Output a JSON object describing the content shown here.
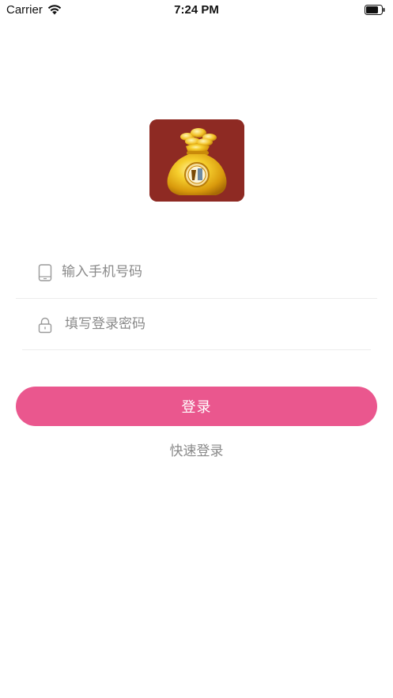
{
  "status_bar": {
    "carrier": "Carrier",
    "time": "7:24 PM",
    "wifi_icon": "wifi-icon",
    "battery_icon": "battery-icon"
  },
  "logo": {
    "icon": "money-bag-icon",
    "background_color": "#8e2a23"
  },
  "form": {
    "phone": {
      "placeholder": "输入手机号码",
      "value": "",
      "icon": "phone-icon"
    },
    "password": {
      "placeholder": "填写登录密码",
      "value": "",
      "icon": "lock-icon"
    },
    "login_label": "登录",
    "quick_login_label": "快速登录"
  },
  "colors": {
    "accent": "#ea578e",
    "placeholder": "#8a8a8a",
    "divider": "#ececec"
  }
}
